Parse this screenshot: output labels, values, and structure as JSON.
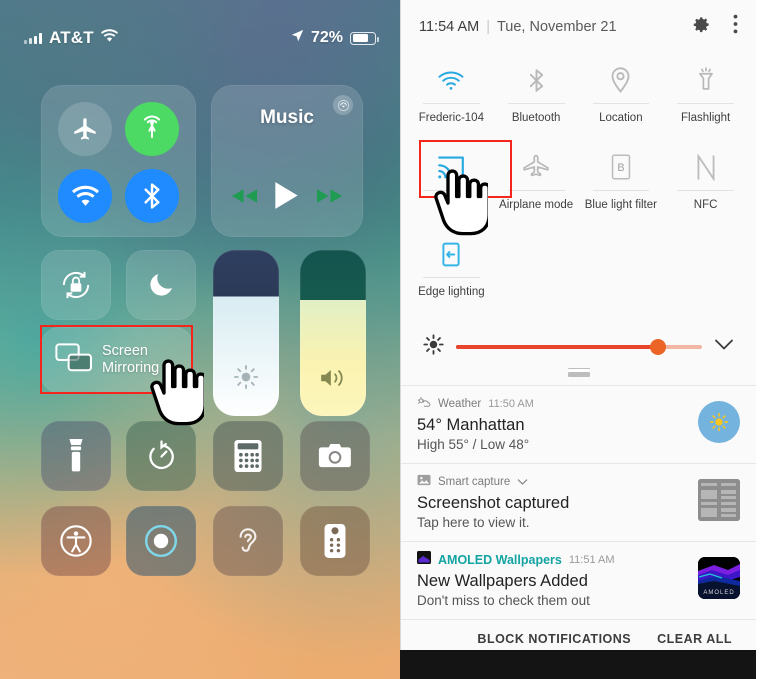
{
  "ios": {
    "status_bar": {
      "carrier": "AT&T",
      "signal_icon": "signal-bars-icon",
      "wifi_icon": "wifi-icon",
      "location_icon": "location-arrow-icon",
      "battery_percent": "72%",
      "battery_icon": "battery-icon"
    },
    "connectivity": {
      "airplane": {
        "icon": "airplane-icon",
        "state": "off"
      },
      "airdrop": {
        "icon": "airdrop-icon",
        "state": "on"
      },
      "wifi": {
        "icon": "wifi-icon",
        "state": "on"
      },
      "bluetooth": {
        "icon": "bluetooth-icon",
        "state": "on"
      }
    },
    "music": {
      "title": "Music",
      "airplay_icon": "airplay-icon",
      "prev_icon": "rewind-icon",
      "play_icon": "play-icon",
      "next_icon": "fast-forward-icon"
    },
    "tiles": {
      "rotation_lock": "rotation-lock-icon",
      "do_not_disturb": "moon-icon",
      "brightness_icon": "brightness-icon",
      "volume_icon": "volume-icon",
      "screen_mirroring_label_line1": "Screen",
      "screen_mirroring_label_line2": "Mirroring",
      "screen_mirroring_icon": "screen-mirroring-icon"
    },
    "bottom_grid": [
      {
        "name": "flashlight",
        "icon": "flashlight-icon"
      },
      {
        "name": "timer",
        "icon": "timer-icon"
      },
      {
        "name": "calculator",
        "icon": "calculator-icon"
      },
      {
        "name": "camera",
        "icon": "camera-icon"
      },
      {
        "name": "accessibility",
        "icon": "accessibility-icon"
      },
      {
        "name": "screen-record",
        "icon": "screen-record-icon"
      },
      {
        "name": "hearing",
        "icon": "hearing-icon"
      },
      {
        "name": "apple-tv-remote",
        "icon": "remote-icon"
      }
    ]
  },
  "android": {
    "header": {
      "time": "11:54 AM",
      "separator": "|",
      "date": "Tue, November 21",
      "settings_icon": "gear-icon",
      "overflow_icon": "three-dots-icon"
    },
    "quick_settings": [
      {
        "label": "Frederic-104",
        "icon": "wifi-icon",
        "state": "on"
      },
      {
        "label": "Bluetooth",
        "icon": "bluetooth-icon",
        "state": "off"
      },
      {
        "label": "Location",
        "icon": "location-pin-icon",
        "state": "off"
      },
      {
        "label": "Flashlight",
        "icon": "flashlight-icon",
        "state": "off"
      },
      {
        "label": "",
        "icon": "cast-icon",
        "state": "on",
        "highlighted": true
      },
      {
        "label": "Airplane mode",
        "icon": "airplane-icon",
        "state": "off"
      },
      {
        "label": "Blue light filter",
        "icon": "blue-light-filter-icon",
        "state": "off"
      },
      {
        "label": "NFC",
        "icon": "nfc-icon",
        "state": "off"
      },
      {
        "label": "Edge lighting",
        "icon": "edge-lighting-icon",
        "state": "on"
      }
    ],
    "brightness": {
      "icon": "brightness-icon",
      "value_percent": 82,
      "expand_icon": "chevron-down-icon",
      "track_color": "#f3b5a4",
      "fill_color": "#e8432b",
      "knob_color": "#ec6526"
    },
    "notifications": [
      {
        "app": "Weather",
        "app_icon": "weather-icon",
        "time": "11:50 AM",
        "title": "54° Manhattan",
        "subtitle": "High 55° / Low 48°",
        "thumb": "sun-thumb"
      },
      {
        "app": "Smart capture",
        "app_icon": "image-icon",
        "time": "",
        "expand_icon": "chevron-down-icon",
        "title": "Screenshot captured",
        "subtitle": "Tap here to view it.",
        "thumb": "screenshot-thumb"
      },
      {
        "app": "AMOLED Wallpapers",
        "app_icon": "amoled-app-icon",
        "time": "11:51 AM",
        "title": "New Wallpapers Added",
        "subtitle": "Don't miss to check them out",
        "thumb": "amoled-thumb",
        "thumb_label": "AMOLED"
      }
    ],
    "footer": {
      "block_label": "BLOCK NOTIFICATIONS",
      "clear_label": "CLEAR ALL"
    }
  },
  "annotations": {
    "highlight_color": "#f5241c",
    "ios_highlight_target": "Screen Mirroring",
    "android_highlight_target": "Cast / Smart View",
    "cursor_icon": "hand-pointer-cursor"
  }
}
